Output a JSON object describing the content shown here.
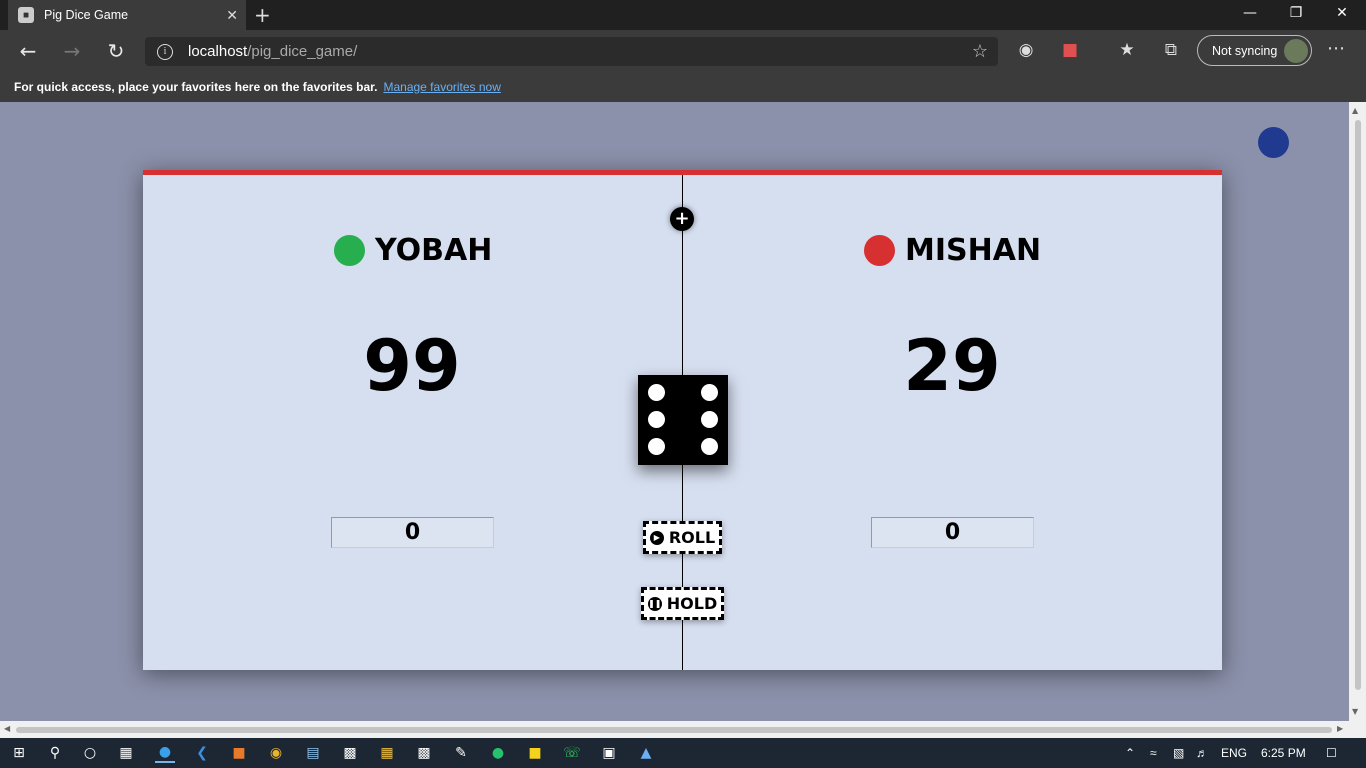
{
  "browser": {
    "tab_title": "Pig Dice Game",
    "url_host": "localhost",
    "url_path": "/pig_dice_game/",
    "sync_label": "Not syncing",
    "favbar_text": "For quick access, place your favorites here on the favorites bar.",
    "favbar_link": "Manage favorites now"
  },
  "game": {
    "accent_color": "#d63031",
    "background_color": "#d6dff0",
    "new_game_icon": "+",
    "players": [
      {
        "name": "YOBAH",
        "score": "99",
        "current": "0",
        "dot_color": "#27ae4f"
      },
      {
        "name": "MISHAN",
        "score": "29",
        "current": "0",
        "dot_color": "#d63031"
      }
    ],
    "dice_value": 6,
    "roll_label": "ROLL",
    "hold_label": "HOLD"
  },
  "taskbar": {
    "language": "ENG",
    "time": "6:25 PM"
  }
}
